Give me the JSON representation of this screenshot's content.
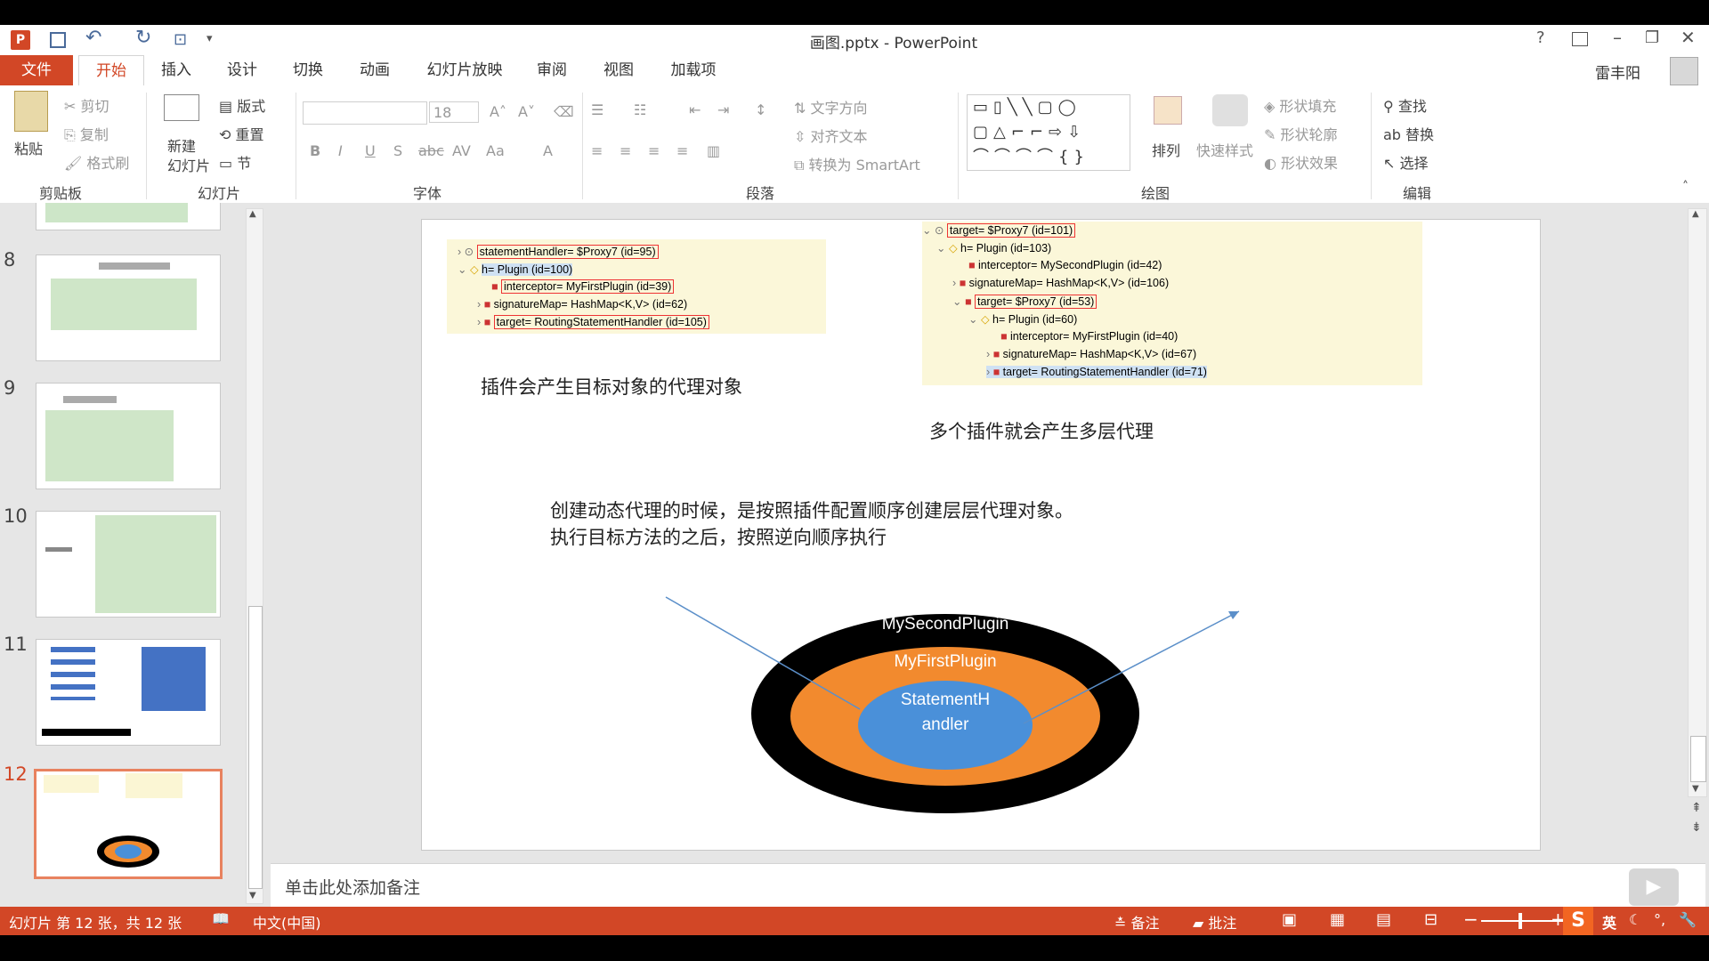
{
  "titlebar": {
    "title": "画图.pptx - PowerPoint",
    "help": "?",
    "user": "雷丰阳"
  },
  "tabs": [
    "文件",
    "开始",
    "插入",
    "设计",
    "切换",
    "动画",
    "幻灯片放映",
    "审阅",
    "视图",
    "加载项"
  ],
  "ribbon": {
    "clipboard": {
      "paste": "粘贴",
      "cut": "剪切",
      "copy": "复制",
      "painter": "格式刷",
      "group": "剪贴板"
    },
    "slides": {
      "new1": "新建",
      "new2": "幻灯片",
      "layout": "版式",
      "reset": "重置",
      "section": "节",
      "group": "幻灯片"
    },
    "font": {
      "size": "18",
      "group": "字体"
    },
    "paragraph": {
      "text_dir": "文字方向",
      "align_text": "对齐文本",
      "smartart": "转换为 SmartArt",
      "group": "段落"
    },
    "drawing": {
      "arrange": "排列",
      "quick_styles": "快速样式",
      "fill": "形状填充",
      "outline": "形状轮廓",
      "effects": "形状效果",
      "group": "绘图"
    },
    "editing": {
      "find": "查找",
      "replace": "替换",
      "select": "选择",
      "group": "编辑"
    }
  },
  "slides": {
    "numbers": [
      "8",
      "9",
      "10",
      "11",
      "12"
    ],
    "current": "12"
  },
  "slide": {
    "tree1": [
      "statementHandler= $Proxy7  (id=95)",
      "h= Plugin  (id=100)",
      "interceptor= MyFirstPlugin  (id=39)",
      "signatureMap= HashMap<K,V>  (id=62)",
      "target= RoutingStatementHandler  (id=105)"
    ],
    "tree2": [
      "target= $Proxy7  (id=101)",
      "h= Plugin  (id=103)",
      "interceptor= MySecondPlugin  (id=42)",
      "signatureMap= HashMap<K,V>  (id=106)",
      "target= $Proxy7  (id=53)",
      "h= Plugin  (id=60)",
      "interceptor= MyFirstPlugin  (id=40)",
      "signatureMap= HashMap<K,V>  (id=67)",
      "target= RoutingStatementHandler  (id=71)"
    ],
    "caption1": "插件会产生目标对象的代理对象",
    "caption2": "多个插件就会产生多层代理",
    "body_line1": "创建动态代理的时候，是按照插件配置顺序创建层层代理对象。",
    "body_line2": "执行目标方法的之后，按照逆向顺序执行",
    "outer": "MySecondPlugin",
    "middle": "MyFirstPlugin",
    "inner1": "StatementH",
    "inner2": "andler"
  },
  "notes_placeholder": "单击此处添加备注",
  "status": {
    "slide_info": "幻灯片 第 12 张，共 12 张",
    "language": "中文(中国)",
    "notes": "备注",
    "comments": "批注",
    "ime": "英"
  }
}
